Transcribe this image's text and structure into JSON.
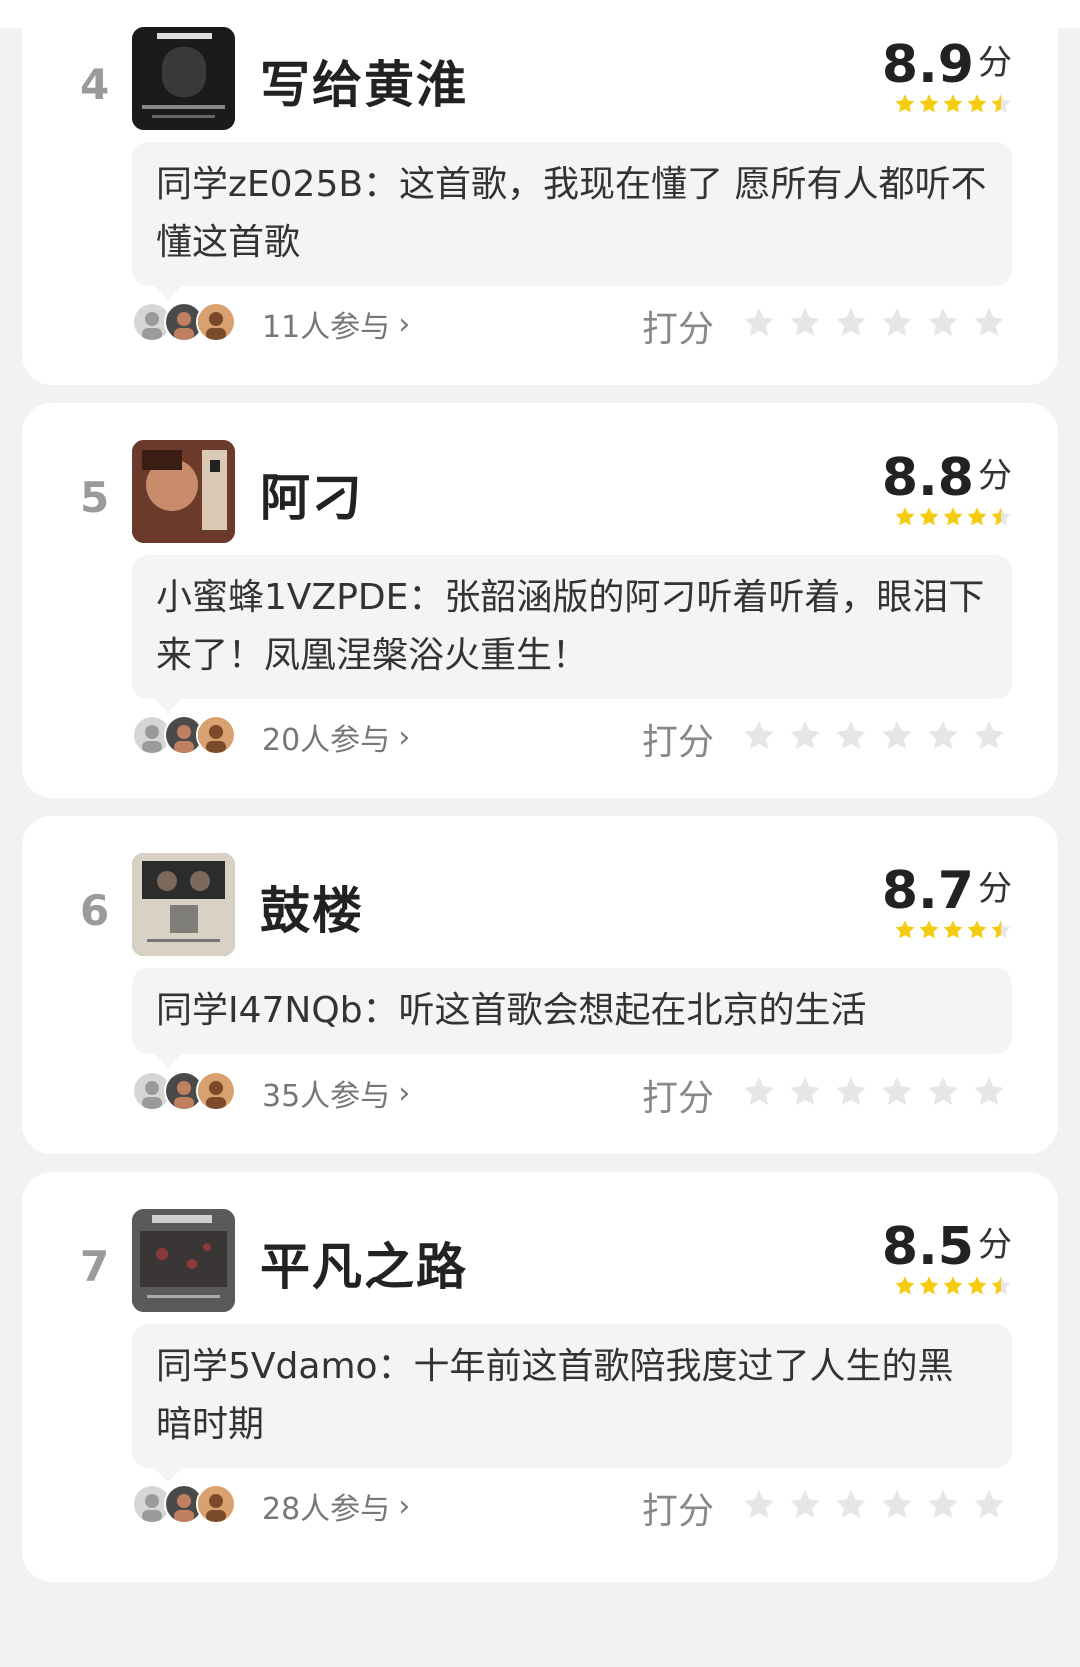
{
  "items": [
    {
      "rank": "4",
      "title": "写给黄淮",
      "score": "8.9",
      "unit": "分",
      "comment": "同学zE025B：这首歌，我现在懂了  愿所有人都听不懂这首歌",
      "participants": "11人参与",
      "rate_label": "打分"
    },
    {
      "rank": "5",
      "title": "阿刁",
      "score": "8.8",
      "unit": "分",
      "comment": "小蜜蜂1VZPDE：张韶涵版的阿刁听着听着，眼泪下来了！凤凰涅槃浴火重生！",
      "participants": "20人参与",
      "rate_label": "打分"
    },
    {
      "rank": "6",
      "title": "鼓楼",
      "score": "8.7",
      "unit": "分",
      "comment": "同学I47NQb：听这首歌会想起在北京的生活",
      "participants": "35人参与",
      "rate_label": "打分"
    },
    {
      "rank": "7",
      "title": "平凡之路",
      "score": "8.5",
      "unit": "分",
      "comment": "同学5Vdamo：十年前这首歌陪我度过了人生的黑暗时期",
      "participants": "28人参与",
      "rate_label": "打分"
    }
  ],
  "colors": {
    "star_fill": "#f5cc0f",
    "star_empty": "#e6e6e6",
    "background": "#f2f2f4",
    "card": "#ffffff",
    "comment_bg": "#f4f4f6"
  },
  "icons": {
    "score_star": "star-icon",
    "rate_star": "star-outline-icon",
    "chevron": "chevron-right-icon"
  }
}
